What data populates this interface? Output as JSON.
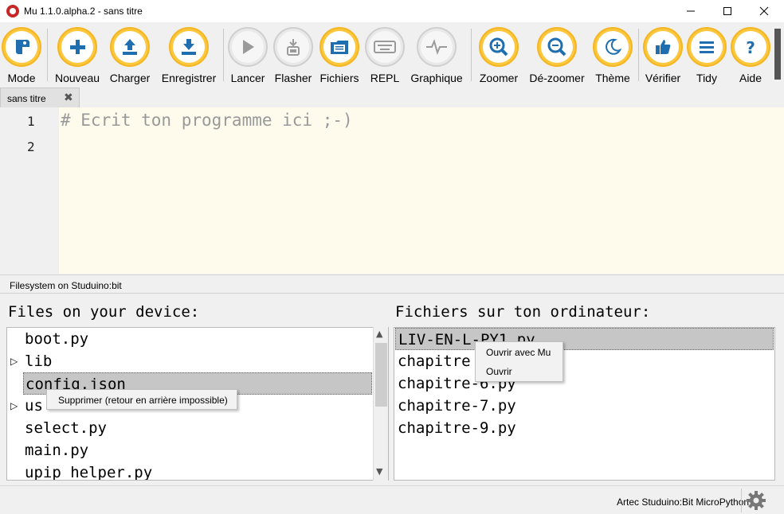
{
  "window": {
    "title": "Mu 1.1.0.alpha.2 - sans titre",
    "controls": [
      "minimize-icon",
      "maximize-icon",
      "close-icon"
    ]
  },
  "toolbar": {
    "buttons": [
      {
        "id": "mode",
        "label": "Mode",
        "icon": "python-logo-icon",
        "active": true
      },
      {
        "id": "nouveau",
        "label": "Nouveau",
        "icon": "plus-icon",
        "active": true
      },
      {
        "id": "charger",
        "label": "Charger",
        "icon": "upload-icon",
        "active": true
      },
      {
        "id": "enregistrer",
        "label": "Enregistrer",
        "icon": "download-icon",
        "active": true
      },
      {
        "id": "lancer",
        "label": "Lancer",
        "icon": "play-icon",
        "active": false
      },
      {
        "id": "flasher",
        "label": "Flasher",
        "icon": "flash-icon",
        "active": false
      },
      {
        "id": "fichiers",
        "label": "Fichiers",
        "icon": "files-icon",
        "active": true
      },
      {
        "id": "repl",
        "label": "REPL",
        "icon": "keyboard-icon",
        "active": false
      },
      {
        "id": "graphique",
        "label": "Graphique",
        "icon": "plotter-icon",
        "active": false
      },
      {
        "id": "zoomer",
        "label": "Zoomer",
        "icon": "zoom-in-icon",
        "active": true
      },
      {
        "id": "dezoomer",
        "label": "Dé-zoomer",
        "icon": "zoom-out-icon",
        "active": true
      },
      {
        "id": "theme",
        "label": "Thème",
        "icon": "moon-icon",
        "active": true
      },
      {
        "id": "verifier",
        "label": "Vérifier",
        "icon": "thumbs-up-icon",
        "active": true
      },
      {
        "id": "tidy",
        "label": "Tidy",
        "icon": "tidy-lines-icon",
        "active": true
      },
      {
        "id": "aide",
        "label": "Aide",
        "icon": "question-icon",
        "active": true
      }
    ]
  },
  "tab": {
    "label": "sans titre",
    "close_icon": "close-icon"
  },
  "editor": {
    "line_numbers": [
      "1",
      "2"
    ],
    "lines": [
      "# Ecrit ton programme ici ;-)",
      ""
    ]
  },
  "filesystem": {
    "header": "Filesystem on Studuino:bit",
    "device_title": "Files on your device:",
    "computer_title": "Fichiers sur ton ordinateur:",
    "device_files": [
      {
        "name": "boot.py",
        "folder": false
      },
      {
        "name": "lib",
        "folder": true
      },
      {
        "name": "config.json",
        "folder": false,
        "selected": true
      },
      {
        "name": "us",
        "folder": true
      },
      {
        "name": "select.py",
        "folder": false
      },
      {
        "name": "main.py",
        "folder": false
      },
      {
        "name": "upip_helper.py",
        "folder": false
      }
    ],
    "computer_files": [
      {
        "name": "LIV-EN-L-PY1.py",
        "selected": true
      },
      {
        "name": "chapitre",
        "selected": false
      },
      {
        "name": "chapitre-6.py",
        "selected": false
      },
      {
        "name": "chapitre-7.py",
        "selected": false
      },
      {
        "name": "chapitre-9.py",
        "selected": false
      }
    ],
    "device_menu": [
      "Supprimer (retour en arrière impossible)"
    ],
    "computer_menu": [
      "Ouvrir avec Mu",
      "Ouvrir"
    ]
  },
  "status": {
    "mode": "Artec Studuino:Bit MicroPython",
    "settings_icon": "gear-icon"
  },
  "colors": {
    "accent": "#fcc73d",
    "editor_bg": "#fefbed",
    "selection": "#c6c6c6"
  }
}
